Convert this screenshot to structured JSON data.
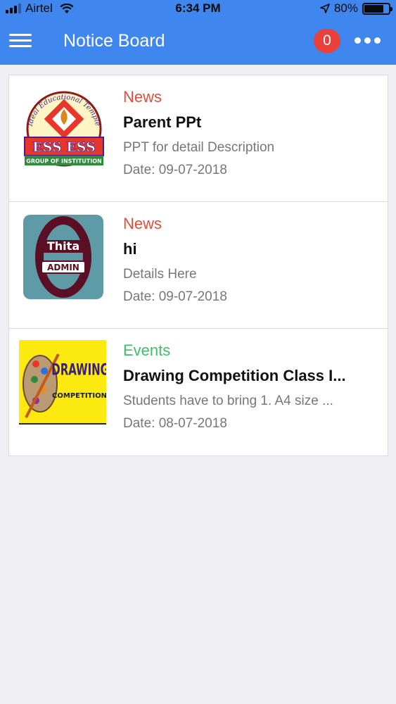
{
  "status_bar": {
    "carrier": "Airtel",
    "time": "6:34 PM",
    "battery": "80%",
    "battery_level": 0.8
  },
  "app_bar": {
    "title": "Notice Board",
    "badge_count": "0",
    "menu_icon": "hamburger-menu-icon",
    "more_icon": "more-horizontal-icon"
  },
  "colors": {
    "primary": "#3f86ee",
    "badge": "#e8403a",
    "news": "#e04e3c",
    "events": "#3fbf6b"
  },
  "notices": [
    {
      "category": "News",
      "title": "Parent PPt",
      "description": "PPT for detail Description",
      "date": "Date: 09-07-2018",
      "logo": {
        "arc": "Ideal Educational Temple",
        "main": "ESS ESS",
        "sub": "GROUP OF INSTITUTION"
      }
    },
    {
      "category": "News",
      "title": "hi",
      "description": "Details Here",
      "date": "Date: 09-07-2018",
      "logo": {
        "main": "Thita",
        "sub": "ADMIN"
      }
    },
    {
      "category": "Events",
      "title": "Drawing Competition Class I...",
      "description": "Students have to bring 1. A4 size ...",
      "date": "Date: 08-07-2018",
      "logo": {
        "main": "DRAWING",
        "sub": "COMPETITION"
      }
    }
  ]
}
